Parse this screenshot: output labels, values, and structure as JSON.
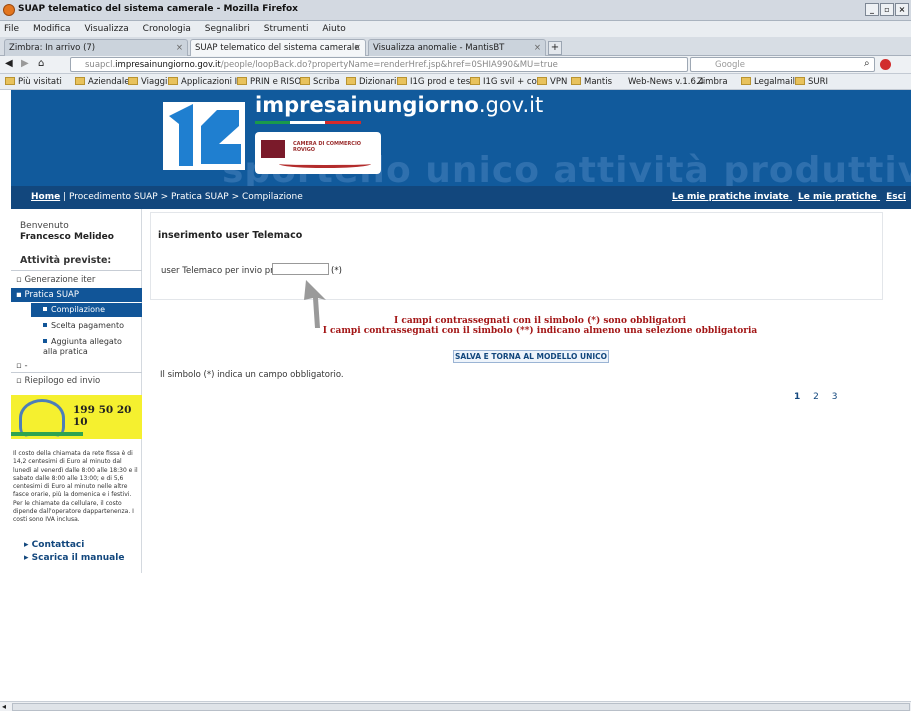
{
  "window": {
    "title": "SUAP telematico del sistema camerale - Mozilla Firefox"
  },
  "menu": [
    "File",
    "Modifica",
    "Visualizza",
    "Cronologia",
    "Segnalibri",
    "Strumenti",
    "Aiuto"
  ],
  "tabs": [
    {
      "label": "Zimbra: In arrivo (7)"
    },
    {
      "label": "SUAP telematico del sistema camerale"
    },
    {
      "label": "Visualizza anomalie - MantisBT"
    }
  ],
  "nav": {
    "url_prefix": "suapcl.",
    "url_domain": "impresainungiorno.gov.it",
    "url_rest": "/people/loopBack.do?propertyName=renderHref.jsp&href=0SHIA990&MU=true",
    "search_placeholder": "Google"
  },
  "bookmarks": [
    "Più visitati",
    "Aziendale",
    "Viaggi",
    "Applicazioni IC",
    "PRIN e RISO",
    "Scriba",
    "Dizionari",
    "I1G prod e test",
    "I1G svil + coll",
    "VPN",
    "Mantis",
    "Web-News v.1.6.4",
    "Zimbra",
    "Legalmail",
    "SURI"
  ],
  "banner": {
    "site_bold": "impresainungiorno",
    "site_rest": ".gov.it",
    "watermark": "sportello unico attività produttive",
    "camera_line1": "CAMERA DI COMMERCIO",
    "camera_line2": "ROVIGO"
  },
  "crumbs": {
    "home": "Home",
    "path": "| Procedimento SUAP > Pratica SUAP > Compilazione",
    "links": [
      "Le mie pratiche inviate",
      "Le mie pratiche",
      "Esci"
    ]
  },
  "sidebar": {
    "welcome": "Benvenuto",
    "user": "Francesco Melideo",
    "activities_title": "Attività previste:",
    "items": [
      "Generazione iter",
      "Pratica SUAP"
    ],
    "subitems": [
      "Compilazione",
      "Scelta pagamento",
      "Aggiunta allegato alla pratica"
    ],
    "extra": "-",
    "riepilogo": "Riepilogo ed invio",
    "phone": "199 50 20 10",
    "cost_text": "Il costo della chiamata da rete fissa è di 14,2 centesimi di Euro al minuto dal lunedì al venerdì dalle 8:00 alle 18:30 e il sabato dalle 8:00 alle 13:00; e di 5,6 centesimi di Euro al minuto nelle altre fasce orarie, più la domenica e i festivi. Per le chiamate da cellulare, il costo dipende dall'operatore dappartenenza. I costi sono IVA inclusa.",
    "contatti": "Contattaci",
    "manuale": "Scarica il manuale"
  },
  "form": {
    "title": "inserimento user Telemaco",
    "label": "user Telemaco per invio pratica:",
    "value": "",
    "req": "(*)"
  },
  "warnings": [
    "I campi contrassegnati con il simbolo (*) sono obbligatori",
    "I campi contrassegnati con il simbolo (**) indicano almeno una selezione obbligatoria"
  ],
  "save_button": "SALVA E TORNA AL MODELLO UNICO",
  "note": "Il simbolo (*) indica un campo obbligatorio.",
  "pages": [
    "1",
    "2",
    "3"
  ]
}
